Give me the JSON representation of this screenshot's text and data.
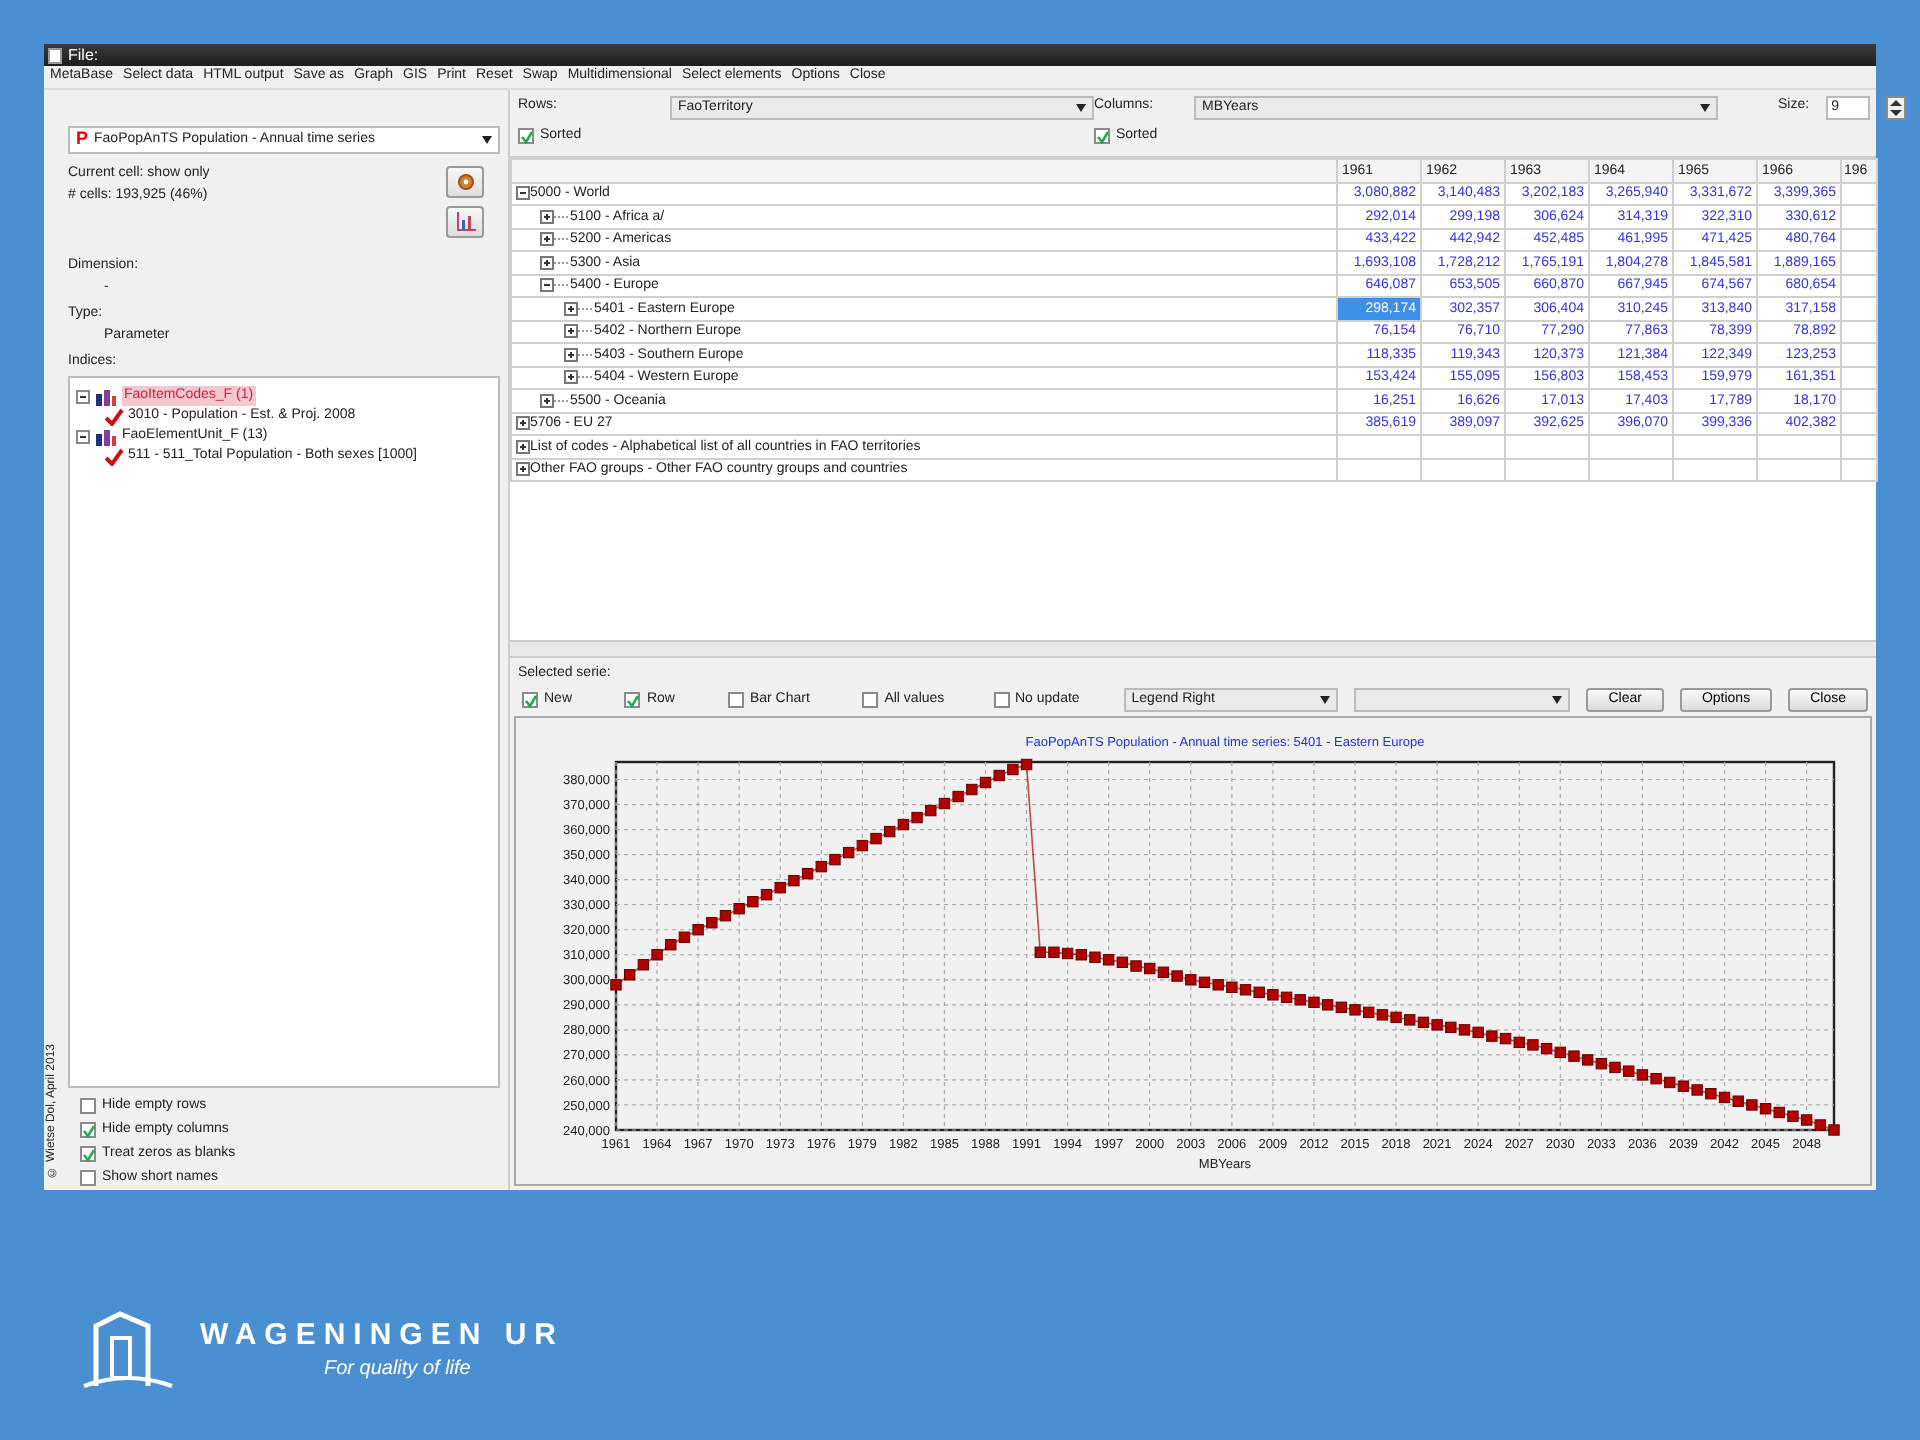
{
  "window": {
    "title": "File:"
  },
  "menu": [
    "MetaBase",
    "Select data",
    "HTML output",
    "Save as",
    "Graph",
    "GIS",
    "Print",
    "Reset",
    "Swap",
    "Multidimensional",
    "Select elements",
    "Options",
    "Close"
  ],
  "left_panel": {
    "source": {
      "icon_letter": "P",
      "value": "FaoPopAnTS Population - Annual time series"
    },
    "info": [
      "Current cell: show only",
      "# cells: 193,925 (46%)"
    ],
    "dimension_label": "Dimension:",
    "dimension_value": "-",
    "type_label": "Type:",
    "type_value": "Parameter",
    "indices_label": "Indices:",
    "indices": [
      {
        "label": "FaoItemCodes_F (1)",
        "selected": true,
        "expanded": true,
        "children": [
          {
            "label": "3010 - Population - Est. & Proj. 2008",
            "checked": true
          }
        ]
      },
      {
        "label": "FaoElementUnit_F (13)",
        "selected": false,
        "expanded": true,
        "children": [
          {
            "label": "511 - 511_Total Population - Both sexes [1000]",
            "checked": true
          }
        ]
      }
    ],
    "options": [
      {
        "label": "Hide empty rows",
        "checked": false
      },
      {
        "label": "Hide empty columns",
        "checked": true
      },
      {
        "label": "Treat zeros as blanks",
        "checked": true
      },
      {
        "label": "Show short names",
        "checked": false
      }
    ],
    "copyright": "© Wietse Dol, April 2013"
  },
  "pivot": {
    "rows_label": "Rows:",
    "rows_value": "FaoTerritory",
    "rows_sorted": {
      "label": "Sorted",
      "checked": true
    },
    "columns_label": "Columns:",
    "columns_value": "MBYears",
    "columns_sorted": {
      "label": "Sorted",
      "checked": true
    },
    "size_label": "Size:",
    "size_value": "9"
  },
  "table": {
    "columns": [
      "1961",
      "1962",
      "1963",
      "1964",
      "1965",
      "1966",
      "196"
    ],
    "rows": [
      {
        "label": "5000 - World",
        "expanded": true,
        "cells": [
          {
            "text": "3,080,882",
            "selected": false
          },
          {
            "text": "3,140,483",
            "selected": false
          },
          {
            "text": "3,202,183",
            "selected": false
          },
          {
            "text": "3,265,940",
            "selected": false
          },
          {
            "text": "3,331,672",
            "selected": false
          },
          {
            "text": "3,399,365",
            "selected": false
          }
        ],
        "children": [
          {
            "label": "5100 - Africa a/",
            "expanded": false,
            "cells": [
              {
                "text": "292,014",
                "selected": false
              },
              {
                "text": "299,198",
                "selected": false
              },
              {
                "text": "306,624",
                "selected": false
              },
              {
                "text": "314,319",
                "selected": false
              },
              {
                "text": "322,310",
                "selected": false
              },
              {
                "text": "330,612",
                "selected": false
              }
            ]
          },
          {
            "label": "5200 - Americas",
            "expanded": false,
            "cells": [
              {
                "text": "433,422",
                "selected": false
              },
              {
                "text": "442,942",
                "selected": false
              },
              {
                "text": "452,485",
                "selected": false
              },
              {
                "text": "461,995",
                "selected": false
              },
              {
                "text": "471,425",
                "selected": false
              },
              {
                "text": "480,764",
                "selected": false
              }
            ]
          },
          {
            "label": "5300 - Asia",
            "expanded": false,
            "cells": [
              {
                "text": "1,693,108",
                "selected": false
              },
              {
                "text": "1,728,212",
                "selected": false
              },
              {
                "text": "1,765,191",
                "selected": false
              },
              {
                "text": "1,804,278",
                "selected": false
              },
              {
                "text": "1,845,581",
                "selected": false
              },
              {
                "text": "1,889,165",
                "selected": false
              }
            ]
          },
          {
            "label": "5400 - Europe",
            "expanded": true,
            "cells": [
              {
                "text": "646,087",
                "selected": false
              },
              {
                "text": "653,505",
                "selected": false
              },
              {
                "text": "660,870",
                "selected": false
              },
              {
                "text": "667,945",
                "selected": false
              },
              {
                "text": "674,567",
                "selected": false
              },
              {
                "text": "680,654",
                "selected": false
              }
            ],
            "children": [
              {
                "label": "5401 - Eastern Europe",
                "expanded": false,
                "cells": [
                  {
                    "text": "298,174",
                    "selected": true
                  },
                  {
                    "text": "302,357",
                    "selected": false
                  },
                  {
                    "text": "306,404",
                    "selected": false
                  },
                  {
                    "text": "310,245",
                    "selected": false
                  },
                  {
                    "text": "313,840",
                    "selected": false
                  },
                  {
                    "text": "317,158",
                    "selected": false
                  }
                ]
              },
              {
                "label": "5402 - Northern Europe",
                "expanded": false,
                "cells": [
                  {
                    "text": "76,154",
                    "selected": false
                  },
                  {
                    "text": "76,710",
                    "selected": false
                  },
                  {
                    "text": "77,290",
                    "selected": false
                  },
                  {
                    "text": "77,863",
                    "selected": false
                  },
                  {
                    "text": "78,399",
                    "selected": false
                  },
                  {
                    "text": "78,892",
                    "selected": false
                  }
                ]
              },
              {
                "label": "5403 - Southern Europe",
                "expanded": false,
                "cells": [
                  {
                    "text": "118,335",
                    "selected": false
                  },
                  {
                    "text": "119,343",
                    "selected": false
                  },
                  {
                    "text": "120,373",
                    "selected": false
                  },
                  {
                    "text": "121,384",
                    "selected": false
                  },
                  {
                    "text": "122,349",
                    "selected": false
                  },
                  {
                    "text": "123,253",
                    "selected": false
                  }
                ]
              },
              {
                "label": "5404 - Western Europe",
                "expanded": false,
                "cells": [
                  {
                    "text": "153,424",
                    "selected": false
                  },
                  {
                    "text": "155,095",
                    "selected": false
                  },
                  {
                    "text": "156,803",
                    "selected": false
                  },
                  {
                    "text": "158,453",
                    "selected": false
                  },
                  {
                    "text": "159,979",
                    "selected": false
                  },
                  {
                    "text": "161,351",
                    "selected": false
                  }
                ]
              }
            ]
          },
          {
            "label": "5500 - Oceania",
            "expanded": false,
            "cells": [
              {
                "text": "16,251",
                "selected": false
              },
              {
                "text": "16,626",
                "selected": false
              },
              {
                "text": "17,013",
                "selected": false
              },
              {
                "text": "17,403",
                "selected": false
              },
              {
                "text": "17,789",
                "selected": false
              },
              {
                "text": "18,170",
                "selected": false
              }
            ]
          }
        ]
      },
      {
        "label": "5706 - EU 27",
        "expanded": false,
        "cells": [
          {
            "text": "385,619",
            "selected": false
          },
          {
            "text": "389,097",
            "selected": false
          },
          {
            "text": "392,625",
            "selected": false
          },
          {
            "text": "396,070",
            "selected": false
          },
          {
            "text": "399,336",
            "selected": false
          },
          {
            "text": "402,382",
            "selected": false
          }
        ]
      },
      {
        "label": "List of codes - Alphabetical list of all countries in FAO territories",
        "expanded": false
      },
      {
        "label": "Other FAO groups - Other FAO country groups and countries",
        "expanded": false
      }
    ]
  },
  "series_panel": {
    "title": "Selected serie:",
    "options": [
      {
        "label": "New",
        "checked": true
      },
      {
        "label": "Row",
        "checked": true
      },
      {
        "label": "Bar Chart",
        "checked": false
      },
      {
        "label": "All values",
        "checked": false
      },
      {
        "label": "No update",
        "checked": false
      }
    ],
    "legend_select": "Legend Right",
    "buttons": [
      "Clear",
      "Options",
      "Close"
    ]
  },
  "chart": {
    "chart_data": {
      "type": "line",
      "title": "FaoPopAnTS Population - Annual time series: 5401 - Eastern Europe",
      "xlabel": "MBYears",
      "x": [
        1961,
        1962,
        1963,
        1964,
        1965,
        1966,
        1967,
        1968,
        1969,
        1970,
        1971,
        1972,
        1973,
        1974,
        1975,
        1976,
        1977,
        1978,
        1979,
        1980,
        1981,
        1982,
        1983,
        1984,
        1985,
        1986,
        1987,
        1988,
        1989,
        1990,
        1991,
        1992,
        1993,
        1994,
        1995,
        1996,
        1997,
        1998,
        1999,
        2000,
        2001,
        2002,
        2003,
        2004,
        2005,
        2006,
        2007,
        2008,
        2009,
        2010,
        2011,
        2012,
        2013,
        2014,
        2015,
        2016,
        2017,
        2018,
        2019,
        2020,
        2021,
        2022,
        2023,
        2024,
        2025,
        2026,
        2027,
        2028,
        2029,
        2030,
        2031,
        2032,
        2033,
        2034,
        2035,
        2036,
        2037,
        2038,
        2039,
        2040,
        2041,
        2042,
        2043,
        2044,
        2045,
        2046,
        2047,
        2048,
        2049,
        2050
      ],
      "grid": true,
      "series": [
        {
          "color": "#b00000",
          "marker": "square",
          "values": [
            298000,
            302000,
            306000,
            310000,
            314000,
            317000,
            320000,
            322800,
            325600,
            328400,
            331200,
            334000,
            336800,
            339600,
            342400,
            345200,
            348000,
            350800,
            353600,
            356400,
            359200,
            362000,
            364800,
            367600,
            370400,
            373200,
            376000,
            378800,
            381600,
            384000,
            386000,
            311000,
            311000,
            310500,
            310000,
            309000,
            308000,
            307000,
            305500,
            304500,
            303000,
            301500,
            300000,
            299000,
            298000,
            297000,
            296000,
            295000,
            294000,
            293000,
            292000,
            291000,
            290000,
            289000,
            288000,
            287000,
            286000,
            285000,
            284000,
            283000,
            282000,
            281000,
            280000,
            279000,
            277500,
            276500,
            275000,
            274000,
            272500,
            271000,
            269500,
            268000,
            266500,
            265000,
            263500,
            262000,
            260500,
            259000,
            257500,
            256000,
            254500,
            253000,
            251500,
            250000,
            248500,
            247000,
            245500,
            244000,
            242000,
            240000
          ]
        }
      ],
      "xlim": [
        1961,
        2050
      ],
      "ylim": [
        240000,
        387000
      ],
      "xticks": [
        1961,
        1964,
        1967,
        1970,
        1973,
        1976,
        1979,
        1982,
        1985,
        1988,
        1991,
        1994,
        1997,
        2000,
        2003,
        2006,
        2009,
        2012,
        2015,
        2018,
        2021,
        2024,
        2027,
        2030,
        2033,
        2036,
        2039,
        2042,
        2045,
        2048
      ],
      "yticks": [
        {
          "value": 240000,
          "label": "240,000"
        },
        {
          "value": 250000,
          "label": "250,000"
        },
        {
          "value": 260000,
          "label": "260,000"
        },
        {
          "value": 270000,
          "label": "270,000"
        },
        {
          "value": 280000,
          "label": "280,000"
        },
        {
          "value": 290000,
          "label": "290,000"
        },
        {
          "value": 300000,
          "label": "300,000"
        },
        {
          "value": 310000,
          "label": "310,000"
        },
        {
          "value": 320000,
          "label": "320,000"
        },
        {
          "value": 330000,
          "label": "330,000"
        },
        {
          "value": 340000,
          "label": "340,000"
        },
        {
          "value": 350000,
          "label": "350,000"
        },
        {
          "value": 360000,
          "label": "360,000"
        },
        {
          "value": 370000,
          "label": "370,000"
        },
        {
          "value": 380000,
          "label": "380,000"
        }
      ]
    }
  },
  "footer": {
    "brand": "WAGENINGEN UR",
    "tagline": "For quality of life"
  }
}
